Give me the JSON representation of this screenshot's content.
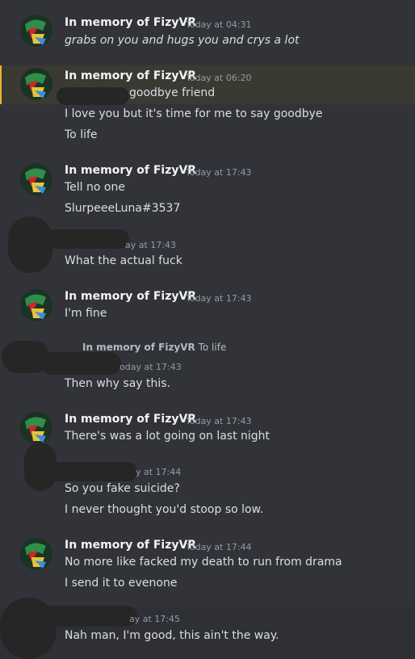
{
  "messages": [
    {
      "user": "In memory of FizyVR",
      "time": "Today at 04:31",
      "lines": [
        "grabs on you and hugs you and crys a lot"
      ]
    },
    {
      "user": "In memory of FizyVR",
      "time": "Today at 06:20",
      "lines": [
        "goodbye friend",
        "I love you but it's time for me to say goodbye",
        "To life"
      ]
    },
    {
      "user": "In memory of FizyVR",
      "time": "Today at 17:43",
      "lines": [
        "Tell no one",
        "SlurpeeeLuna#3537"
      ]
    },
    {
      "time": "ay at 17:43",
      "lines": [
        "What the actual fuck"
      ]
    },
    {
      "user": "In memory of FizyVR",
      "time": "Today at 17:43",
      "lines": [
        "I'm fine"
      ]
    },
    {
      "reply_user": "In memory of FizyVR",
      "reply_text": "To life",
      "time": "oday at 17:43",
      "lines": [
        "Then why say this."
      ]
    },
    {
      "user": "In memory of FizyVR",
      "time": "Today at 17:43",
      "lines": [
        "There's was a lot going on last night"
      ]
    },
    {
      "time": "y at 17:44",
      "lines": [
        "So you fake suicide?",
        "I never thought you'd stoop so low."
      ]
    },
    {
      "user": "In memory of FizyVR",
      "time": "Today at 17:44",
      "lines": [
        "No more like facked my death to run from drama",
        "I send it to evenone"
      ]
    },
    {
      "time": "ay at 17:45",
      "lines": [
        "Nah man, I'm good, this ain't the way."
      ]
    }
  ]
}
